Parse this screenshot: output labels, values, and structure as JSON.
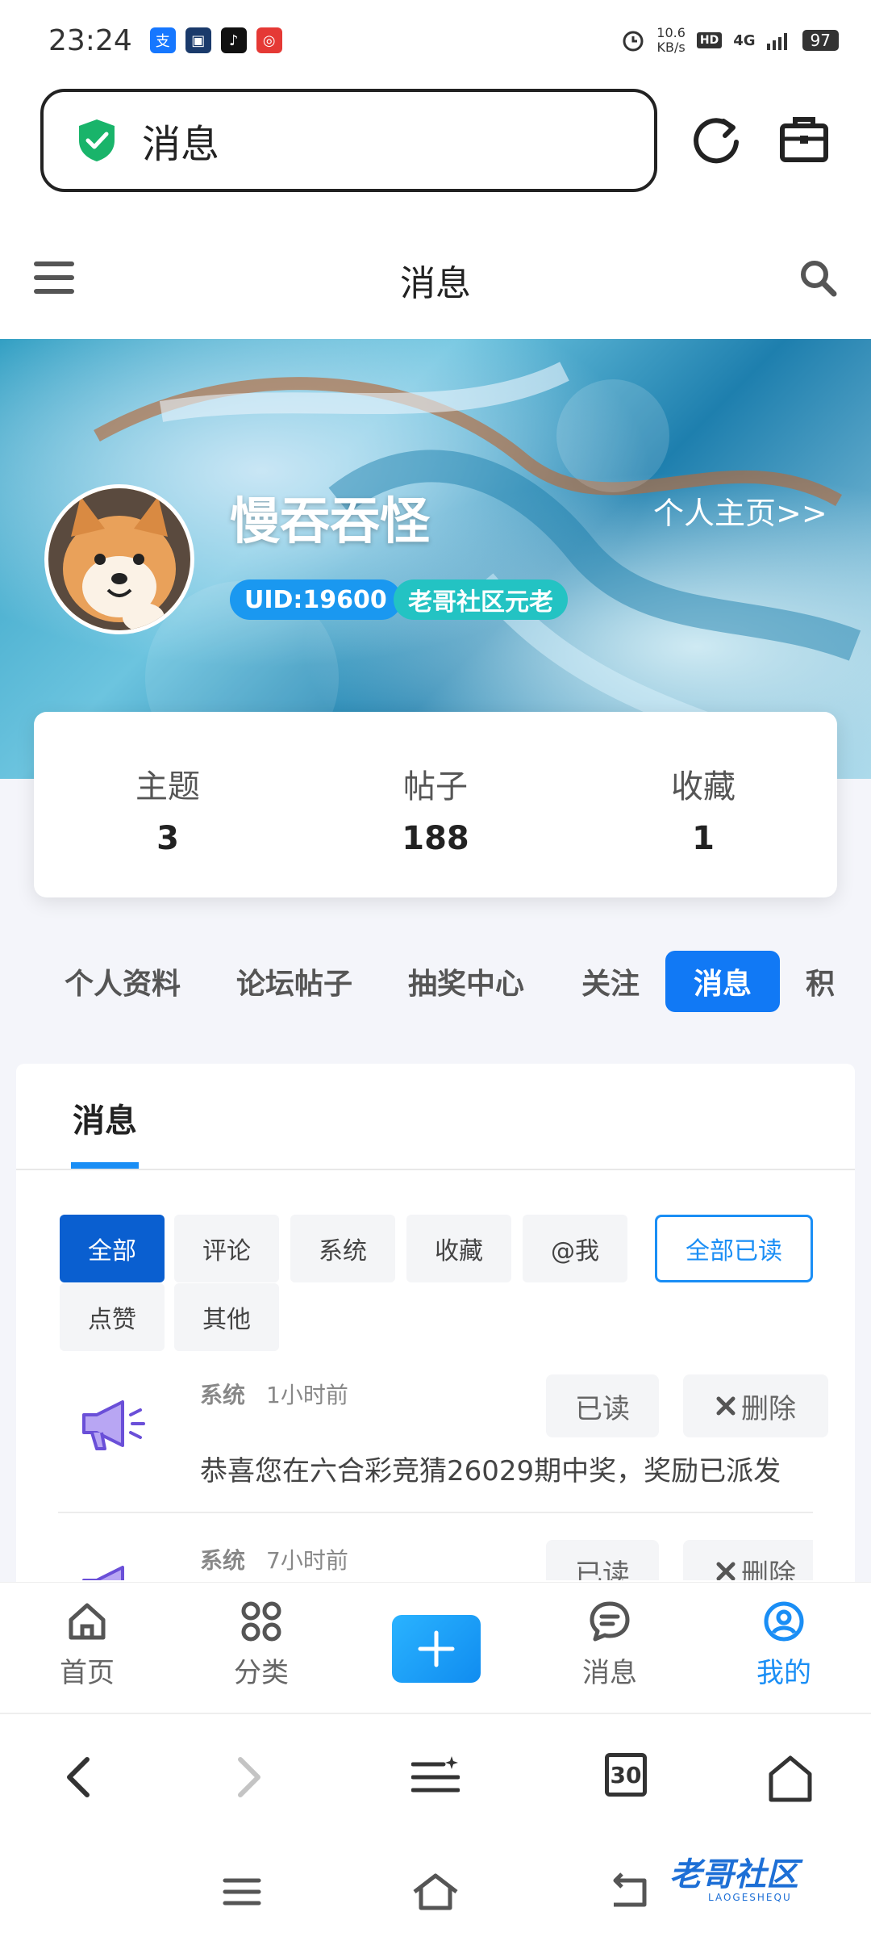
{
  "status_bar": {
    "time": "23:24",
    "net_speed_value": "10.6",
    "net_speed_unit": "KB/s",
    "hd": "HD",
    "network": "4G",
    "battery": "97"
  },
  "url_bar": {
    "text": "消息"
  },
  "header": {
    "title": "消息"
  },
  "profile": {
    "username": "慢吞吞怪",
    "home_link": "个人主页>>",
    "uid_badge": "UID:19600",
    "role_badge": "老哥社区元老"
  },
  "stats": [
    {
      "label": "主题",
      "value": "3"
    },
    {
      "label": "帖子",
      "value": "188"
    },
    {
      "label": "收藏",
      "value": "1"
    }
  ],
  "tabs": [
    {
      "label": "个人资料"
    },
    {
      "label": "论坛帖子"
    },
    {
      "label": "抽奖中心"
    },
    {
      "label": "关注"
    },
    {
      "label": "消息"
    },
    {
      "label": "积"
    }
  ],
  "panel": {
    "tab_label": "消息",
    "filters": [
      "全部",
      "评论",
      "系统",
      "收藏",
      "@我",
      "点赞",
      "其他"
    ],
    "mark_all_read": "全部已读",
    "messages": [
      {
        "type": "系统",
        "time": "1小时前",
        "read_label": "已读",
        "delete_label": "删除",
        "content": "恭喜您在六合彩竞猜26029期中奖，奖励已派发"
      },
      {
        "type": "系统",
        "time": "7小时前",
        "read_label": "已读",
        "delete_label": "删除",
        "content": ""
      }
    ]
  },
  "bottom_nav": [
    {
      "label": "首页"
    },
    {
      "label": "分类"
    },
    {
      "label": "消息"
    },
    {
      "label": "我的"
    }
  ],
  "browser_toolbar": {
    "tab_count": "30"
  },
  "watermark": {
    "text": "老哥社区",
    "sub": "LAOGESHEQU"
  },
  "colors": {
    "accent": "#1179f5",
    "active_filter": "#0a5fd0",
    "uid_badge": "#1a98f0",
    "role_badge": "#23c3c3"
  }
}
